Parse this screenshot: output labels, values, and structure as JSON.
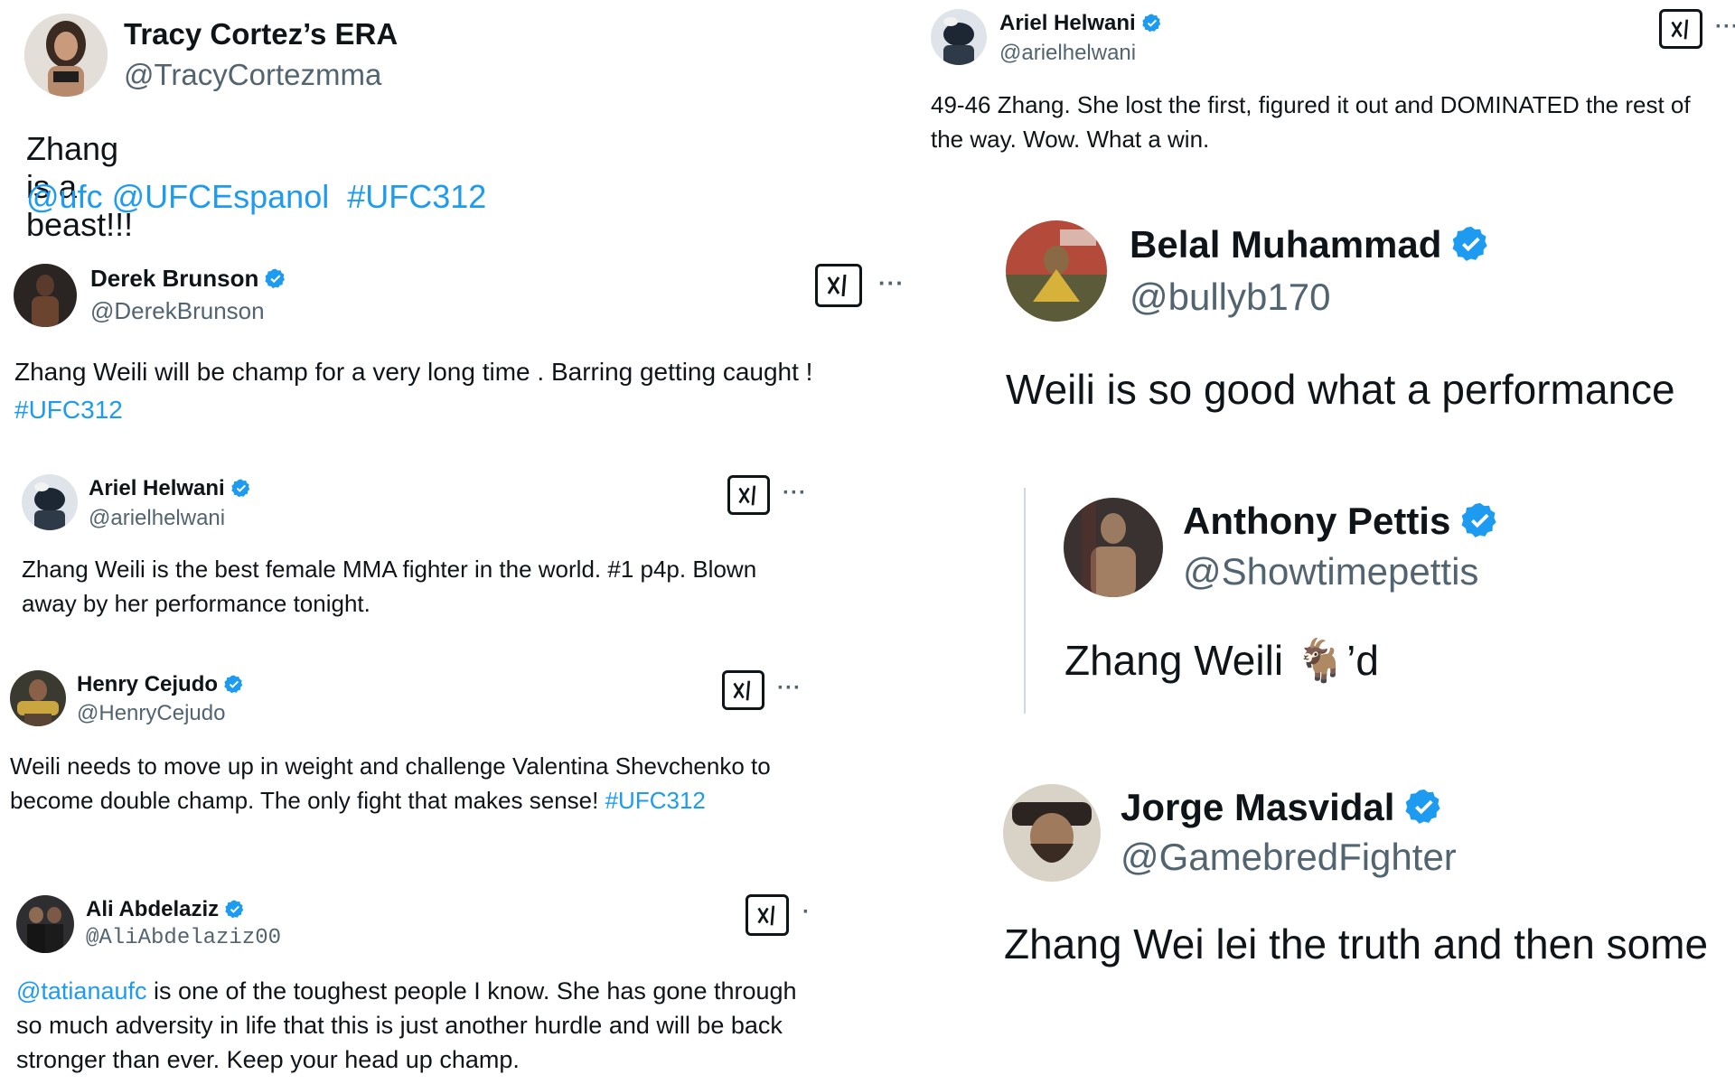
{
  "colors": {
    "text": "#0f1419",
    "muted": "#536471",
    "link": "#1d9bf0",
    "verified": "#1d9bf0"
  },
  "icons": {
    "verified": "verified-badge-icon",
    "grok": "grok-icon",
    "more": "more-icon",
    "goat": "goat-emoji"
  },
  "left": {
    "tracy": {
      "name": "Tracy Cortez’s ERA",
      "handle": "@TracyCortezmma",
      "text": "Zhang is a beast!!!",
      "link1": "@ufc",
      "link2": "@UFCEspanol",
      "link3": "#UFC312"
    },
    "derek": {
      "name": "Derek Brunson",
      "handle": "@DerekBrunson",
      "text": "Zhang Weili will be champ for a very long time . Barring getting caught !",
      "tag": "#UFC312"
    },
    "ariel": {
      "name": "Ariel Helwani",
      "handle": "@arielhelwani",
      "text": "Zhang Weili is the best female MMA fighter in the world. #1 p4p. Blown away by her performance tonight."
    },
    "henry": {
      "name": "Henry Cejudo",
      "handle": "@HenryCejudo",
      "text": "Weili needs to move up in weight and challenge Valentina Shevchenko to become double champ. The only fight that makes sense!",
      "tag": "#UFC312"
    },
    "ali": {
      "name": "Ali Abdelaziz",
      "handle": "@AliAbdelaziz00",
      "mention": "@tatianaufc",
      "text": " is one of the toughest people I know. She has gone through so much adversity in life that this is just another hurdle and will be back stronger than ever. Keep your head up champ."
    }
  },
  "right": {
    "ariel": {
      "name": "Ariel Helwani",
      "handle": "@arielhelwani",
      "text": "49-46 Zhang. She lost the first, figured it out and DOMINATED the rest of the way. Wow. What a win."
    },
    "belal": {
      "name": "Belal Muhammad",
      "handle": "@bullyb170",
      "text": "Weili is so good what a performance"
    },
    "anthony": {
      "name": "Anthony Pettis",
      "handle": "@Showtimepettis",
      "text_before": "Zhang Weili",
      "goat": "🐐",
      "text_after": "’d"
    },
    "jorge": {
      "name": "Jorge Masvidal",
      "handle": "@GamebredFighter",
      "text": "Zhang Wei lei the truth and then some"
    }
  },
  "more_label": "···",
  "ali_more_label": "·"
}
